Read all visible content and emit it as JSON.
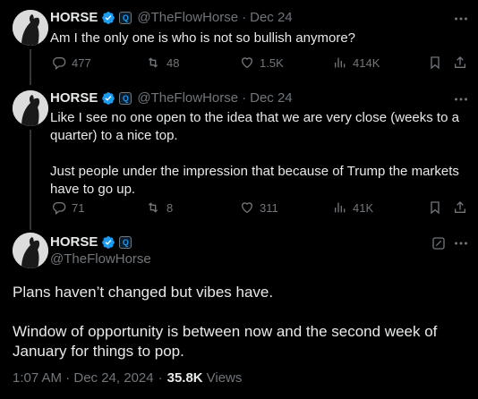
{
  "author": {
    "name": "HORSE",
    "handle": "@TheFlowHorse",
    "affiliate_badge": "Q"
  },
  "tweets": [
    {
      "date": "Dec 24",
      "text": "Am I the only one is who is not so bullish anymore?",
      "replies": "477",
      "reposts": "48",
      "likes": "1.5K",
      "views": "414K"
    },
    {
      "date": "Dec 24",
      "paragraphs": [
        "Like I see no one open to the idea that we are very close (weeks to a quarter) to a nice top.",
        "Just people under the impression that because of Trump the markets have to go up."
      ],
      "replies": "71",
      "reposts": "8",
      "likes": "311",
      "views": "41K"
    }
  ],
  "main_tweet": {
    "paragraphs": [
      "Plans haven’t changed but vibes have.",
      "Window of opportunity is between now and the second week of January for things to pop."
    ],
    "timestamp": "1:07 AM · Dec 24, 2024",
    "views_count": "35.8K",
    "views_label": "Views"
  },
  "colors": {
    "background": "#000000",
    "text": "#e7e9ea",
    "muted": "#71767b",
    "verified": "#1d9bf0"
  }
}
